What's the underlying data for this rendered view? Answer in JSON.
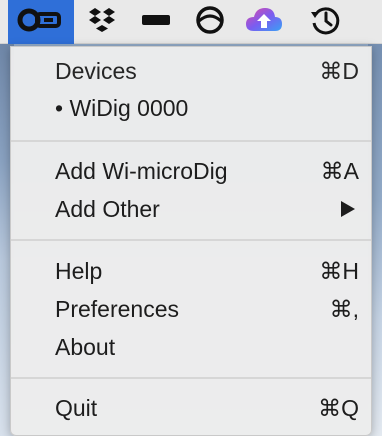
{
  "menubar": {
    "items": [
      {
        "icon": "app-key-icon",
        "selected": true
      },
      {
        "icon": "dropbox-icon"
      },
      {
        "icon": "battery-bar-icon"
      },
      {
        "icon": "circle-sync-icon"
      },
      {
        "icon": "cloud-upload-icon"
      },
      {
        "icon": "time-machine-icon"
      }
    ],
    "accent": "#2f6fd8"
  },
  "menu": {
    "devices_header": "Devices",
    "devices_shortcut": "⌘D",
    "device_item": "• WiDig 0000",
    "add_wi_label": "Add Wi-microDig",
    "add_wi_shortcut": "⌘A",
    "add_other_label": "Add Other",
    "help_label": "Help",
    "help_shortcut": "⌘H",
    "preferences_label": "Preferences",
    "preferences_shortcut": "⌘,",
    "about_label": "About",
    "quit_label": "Quit",
    "quit_shortcut": "⌘Q"
  }
}
